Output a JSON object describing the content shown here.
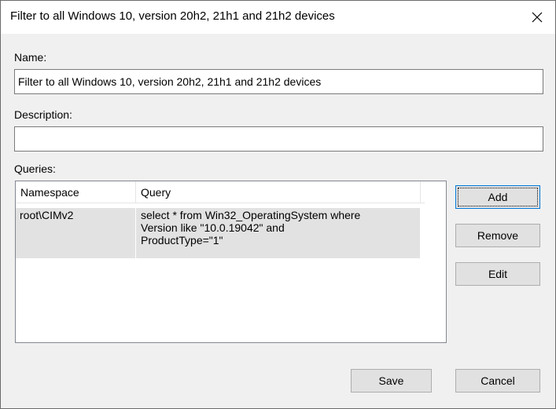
{
  "window": {
    "title": "Filter to all Windows 10, version 20h2, 21h1 and 21h2 devices"
  },
  "form": {
    "name_label": "Name:",
    "name_value": "Filter to all Windows 10, version 20h2, 21h1 and 21h2 devices",
    "description_label": "Description:",
    "description_value": "",
    "queries_label": "Queries:"
  },
  "queries_table": {
    "columns": [
      "Namespace",
      "Query"
    ],
    "rows": [
      {
        "namespace": "root\\CIMv2",
        "query": "select * from Win32_OperatingSystem  where\nVersion like \"10.0.19042\" and\nProductType=\"1\""
      }
    ]
  },
  "buttons": {
    "add": "Add",
    "remove": "Remove",
    "edit": "Edit",
    "save": "Save",
    "cancel": "Cancel"
  },
  "icons": {
    "close": "close-icon"
  }
}
